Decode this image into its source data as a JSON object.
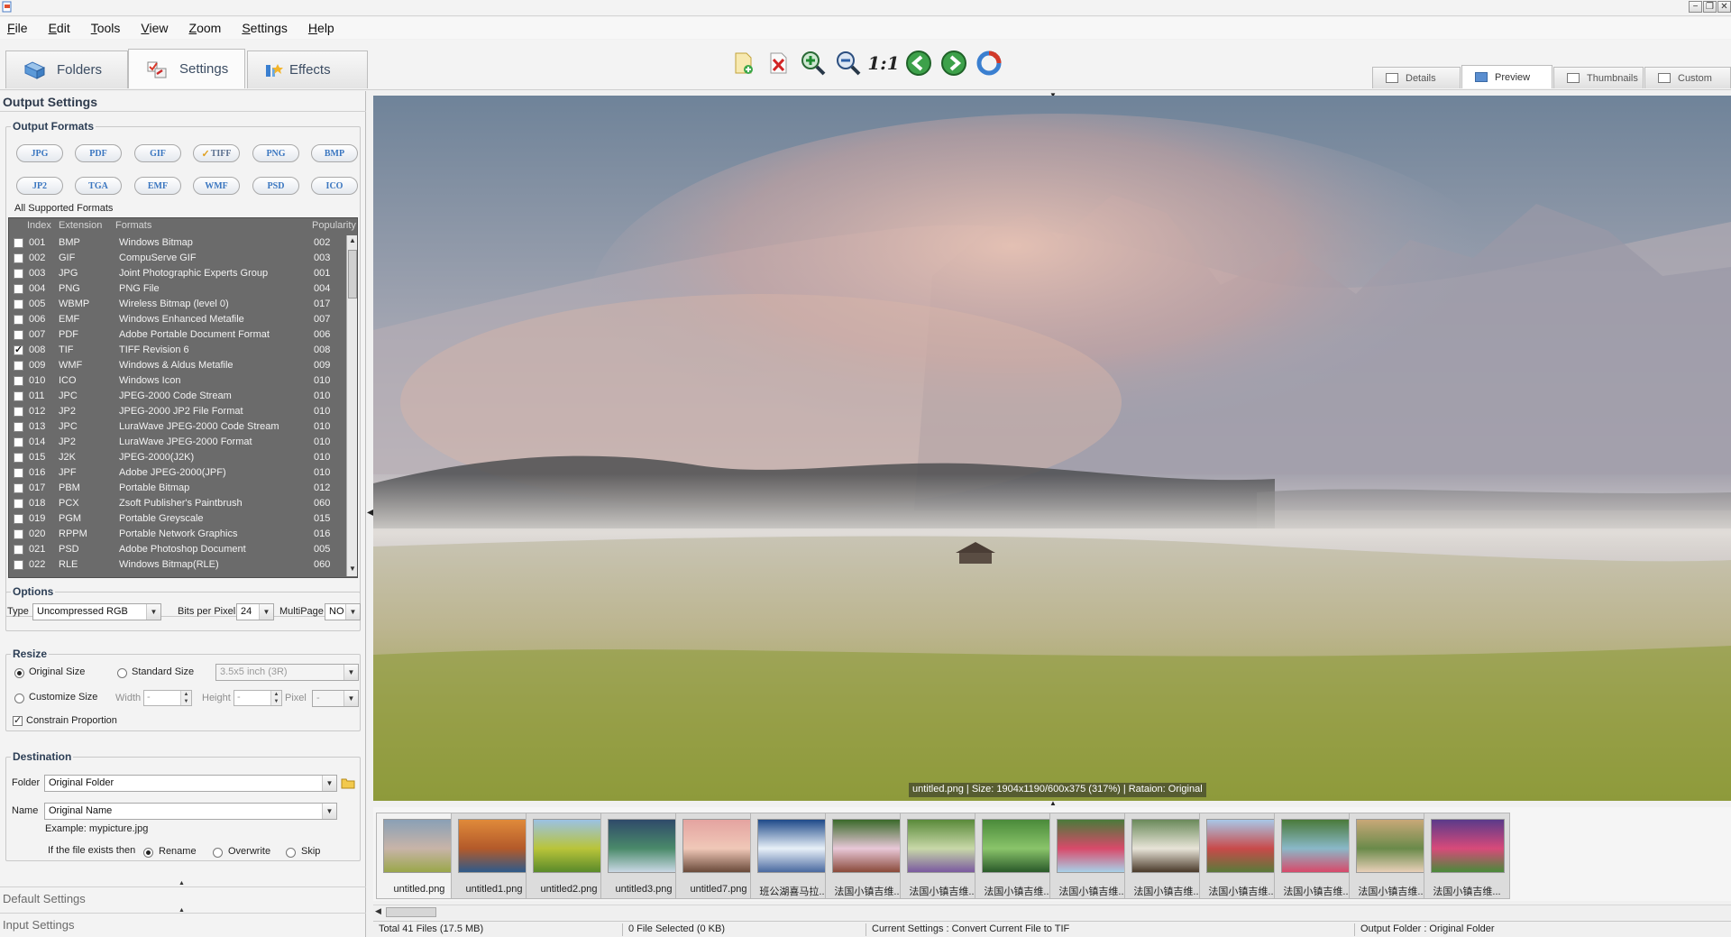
{
  "menu": [
    "File",
    "Edit",
    "Tools",
    "View",
    "Zoom",
    "Settings",
    "Help"
  ],
  "window_buttons": [
    "−",
    "❐",
    "✕"
  ],
  "main_tabs": [
    {
      "label": "Folders",
      "icon": "folders-icon"
    },
    {
      "label": "Settings",
      "icon": "settings-icon"
    },
    {
      "label": "Effects",
      "icon": "effects-icon"
    }
  ],
  "toolbar_icons": [
    "open-icon",
    "delete-icon",
    "zoom-in-icon",
    "zoom-out-icon",
    "actual-size-icon",
    "previous-icon",
    "next-icon",
    "refresh-icon"
  ],
  "toolbar_actual_size_label": "1:1",
  "view_tabs": [
    "Details",
    "Preview",
    "Thumbnails",
    "Custom"
  ],
  "panel_title": "Output Settings",
  "output_formats": {
    "label": "Output Formats",
    "buttons": [
      "JPG",
      "PDF",
      "GIF",
      "TIFF",
      "PNG",
      "BMP",
      "JP2",
      "TGA",
      "EMF",
      "WMF",
      "PSD",
      "ICO"
    ],
    "selected": "TIFF",
    "all_supported_label": "All Supported Formats"
  },
  "format_table": {
    "columns": [
      "Index",
      "Extension",
      "Formats",
      "Popularity"
    ],
    "rows": [
      {
        "index": "001",
        "ext": "BMP",
        "format": "Windows Bitmap",
        "pop": "002",
        "checked": false
      },
      {
        "index": "002",
        "ext": "GIF",
        "format": "CompuServe GIF",
        "pop": "003",
        "checked": false
      },
      {
        "index": "003",
        "ext": "JPG",
        "format": "Joint Photographic Experts Group",
        "pop": "001",
        "checked": false
      },
      {
        "index": "004",
        "ext": "PNG",
        "format": "PNG File",
        "pop": "004",
        "checked": false
      },
      {
        "index": "005",
        "ext": "WBMP",
        "format": "Wireless Bitmap (level 0)",
        "pop": "017",
        "checked": false
      },
      {
        "index": "006",
        "ext": "EMF",
        "format": "Windows Enhanced Metafile",
        "pop": "007",
        "checked": false
      },
      {
        "index": "007",
        "ext": "PDF",
        "format": "Adobe Portable Document Format",
        "pop": "006",
        "checked": false
      },
      {
        "index": "008",
        "ext": "TIF",
        "format": "TIFF Revision 6",
        "pop": "008",
        "checked": true
      },
      {
        "index": "009",
        "ext": "WMF",
        "format": "Windows & Aldus Metafile",
        "pop": "009",
        "checked": false
      },
      {
        "index": "010",
        "ext": "ICO",
        "format": "Windows Icon",
        "pop": "010",
        "checked": false
      },
      {
        "index": "011",
        "ext": "JPC",
        "format": "JPEG-2000 Code Stream",
        "pop": "010",
        "checked": false
      },
      {
        "index": "012",
        "ext": "JP2",
        "format": "JPEG-2000 JP2 File Format",
        "pop": "010",
        "checked": false
      },
      {
        "index": "013",
        "ext": "JPC",
        "format": "LuraWave JPEG-2000 Code Stream",
        "pop": "010",
        "checked": false
      },
      {
        "index": "014",
        "ext": "JP2",
        "format": "LuraWave JPEG-2000 Format",
        "pop": "010",
        "checked": false
      },
      {
        "index": "015",
        "ext": "J2K",
        "format": "JPEG-2000(J2K)",
        "pop": "010",
        "checked": false
      },
      {
        "index": "016",
        "ext": "JPF",
        "format": "Adobe JPEG-2000(JPF)",
        "pop": "010",
        "checked": false
      },
      {
        "index": "017",
        "ext": "PBM",
        "format": "Portable Bitmap",
        "pop": "012",
        "checked": false
      },
      {
        "index": "018",
        "ext": "PCX",
        "format": "Zsoft Publisher's Paintbrush",
        "pop": "060",
        "checked": false
      },
      {
        "index": "019",
        "ext": "PGM",
        "format": "Portable Greyscale",
        "pop": "015",
        "checked": false
      },
      {
        "index": "020",
        "ext": "RPPM",
        "format": "Portable Network Graphics",
        "pop": "016",
        "checked": false
      },
      {
        "index": "021",
        "ext": "PSD",
        "format": "Adobe Photoshop Document",
        "pop": "005",
        "checked": false
      },
      {
        "index": "022",
        "ext": "RLE",
        "format": "Windows Bitmap(RLE)",
        "pop": "060",
        "checked": false
      }
    ]
  },
  "options": {
    "label": "Options",
    "type_label": "Type",
    "type_value": "Uncompressed RGB",
    "bpp_label": "Bits per Pixel",
    "bpp_value": "24",
    "multipage_label": "MultiPage",
    "multipage_value": "NO"
  },
  "resize": {
    "label": "Resize",
    "original_size": "Original Size",
    "standard_size": "Standard Size",
    "standard_value": "3.5x5 inch (3R)",
    "customize_size": "Customize Size",
    "width_label": "Width",
    "width_value": "-",
    "height_label": "Height",
    "height_value": "-",
    "pixel_label": "Pixel",
    "pixel_value": "-",
    "constrain": "Constrain Proportion"
  },
  "destination": {
    "label": "Destination",
    "folder_label": "Folder",
    "folder_value": "Original Folder",
    "name_label": "Name",
    "name_value": "Original Name",
    "example": "Example: mypicture.jpg",
    "exists_label": "If the file exists then",
    "rename": "Rename",
    "overwrite": "Overwrite",
    "skip": "Skip"
  },
  "collapsed_sections": [
    "Default Settings",
    "Input Settings"
  ],
  "preview_caption": "untitled.png  |  Size: 1904x1190/600x375 (317%)  |  Rataion: Original",
  "thumbnails": [
    "untitled.png",
    "untitled1.png",
    "untitled2.png",
    "untitled3.png",
    "untitled7.png",
    "班公湖喜马拉...",
    "法国小镇吉维...",
    "法国小镇吉维...",
    "法国小镇吉维...",
    "法国小镇吉维...",
    "法国小镇吉维...",
    "法国小镇吉维...",
    "法国小镇吉维...",
    "法国小镇吉维...",
    "法国小镇吉维..."
  ],
  "status": {
    "total": "Total 41 Files (17.5 MB)",
    "selected": "0 File Selected (0 KB)",
    "current": "Current Settings : Convert Current File to TIF",
    "output": "Output Folder : Original Folder"
  }
}
